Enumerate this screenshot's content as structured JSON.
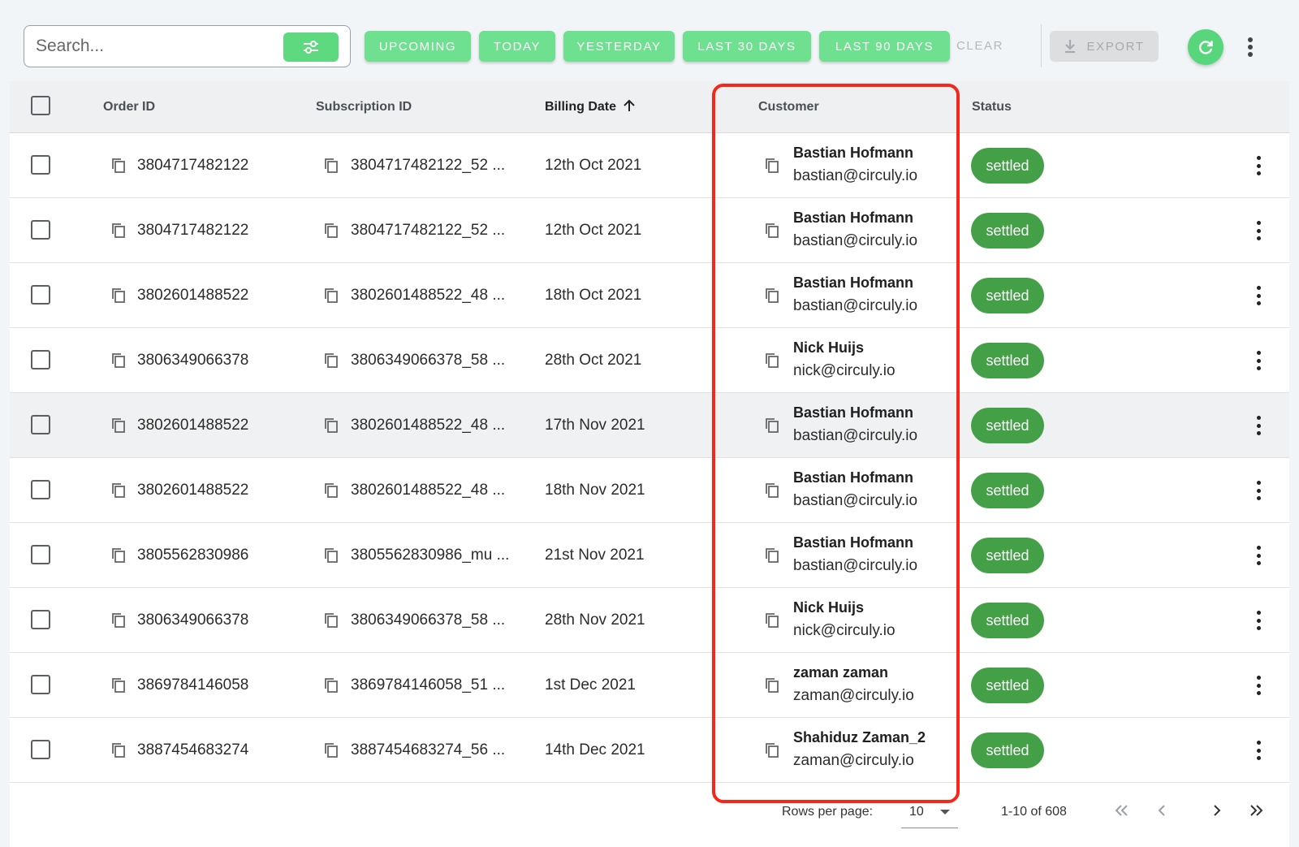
{
  "toolbar": {
    "search_placeholder": "Search...",
    "filter_icon": "filter-sliders-icon",
    "chips": [
      "UPCOMING",
      "TODAY",
      "YESTERDAY",
      "LAST 30 DAYS",
      "LAST 90 DAYS"
    ],
    "clear_label": "CLEAR",
    "export_label": "EXPORT",
    "refresh_icon": "refresh-icon",
    "more_icon": "more-vert-icon"
  },
  "table": {
    "columns": {
      "order_id": "Order ID",
      "subscription_id": "Subscription ID",
      "billing_date": "Billing Date",
      "customer": "Customer",
      "status": "Status"
    },
    "sort_icon": "arrow-up-icon",
    "rows": [
      {
        "order_id": "3804717482122",
        "subscription_id": "3804717482122_52 ...",
        "billing_date": "12th Oct 2021",
        "customer_name": "Bastian Hofmann",
        "customer_email": "bastian@circuly.io",
        "status": "settled"
      },
      {
        "order_id": "3804717482122",
        "subscription_id": "3804717482122_52 ...",
        "billing_date": "12th Oct 2021",
        "customer_name": "Bastian Hofmann",
        "customer_email": "bastian@circuly.io",
        "status": "settled"
      },
      {
        "order_id": "3802601488522",
        "subscription_id": "3802601488522_48 ...",
        "billing_date": "18th Oct 2021",
        "customer_name": "Bastian Hofmann",
        "customer_email": "bastian@circuly.io",
        "status": "settled"
      },
      {
        "order_id": "3806349066378",
        "subscription_id": "3806349066378_58 ...",
        "billing_date": "28th Oct 2021",
        "customer_name": "Nick Huijs",
        "customer_email": "nick@circuly.io",
        "status": "settled"
      },
      {
        "order_id": "3802601488522",
        "subscription_id": "3802601488522_48 ...",
        "billing_date": "17th Nov 2021",
        "customer_name": "Bastian Hofmann",
        "customer_email": "bastian@circuly.io",
        "status": "settled"
      },
      {
        "order_id": "3802601488522",
        "subscription_id": "3802601488522_48 ...",
        "billing_date": "18th Nov 2021",
        "customer_name": "Bastian Hofmann",
        "customer_email": "bastian@circuly.io",
        "status": "settled"
      },
      {
        "order_id": "3805562830986",
        "subscription_id": "3805562830986_mu ...",
        "billing_date": "21st Nov 2021",
        "customer_name": "Bastian Hofmann",
        "customer_email": "bastian@circuly.io",
        "status": "settled"
      },
      {
        "order_id": "3806349066378",
        "subscription_id": "3806349066378_58 ...",
        "billing_date": "28th Nov 2021",
        "customer_name": "Nick Huijs",
        "customer_email": "nick@circuly.io",
        "status": "settled"
      },
      {
        "order_id": "3869784146058",
        "subscription_id": "3869784146058_51 ...",
        "billing_date": "1st Dec 2021",
        "customer_name": "zaman zaman",
        "customer_email": "zaman@circuly.io",
        "status": "settled"
      },
      {
        "order_id": "3887454683274",
        "subscription_id": "3887454683274_56 ...",
        "billing_date": "14th Dec 2021",
        "customer_name": "Shahiduz Zaman_2",
        "customer_email": "zaman@circuly.io",
        "status": "settled"
      }
    ],
    "copy_icon": "copy-icon",
    "row_more_icon": "more-vert-icon"
  },
  "pagination": {
    "rows_per_page_label": "Rows per page:",
    "rows_per_page_value": "10",
    "range": "1-10 of 608",
    "first_icon": "first-page-icon",
    "prev_icon": "prev-page-icon",
    "next_icon": "next-page-icon",
    "last_icon": "last-page-icon"
  },
  "colors": {
    "chip": "#6fe08f",
    "status": "#43a047",
    "highlight": "#f5261b",
    "refresh": "#58d67b"
  }
}
